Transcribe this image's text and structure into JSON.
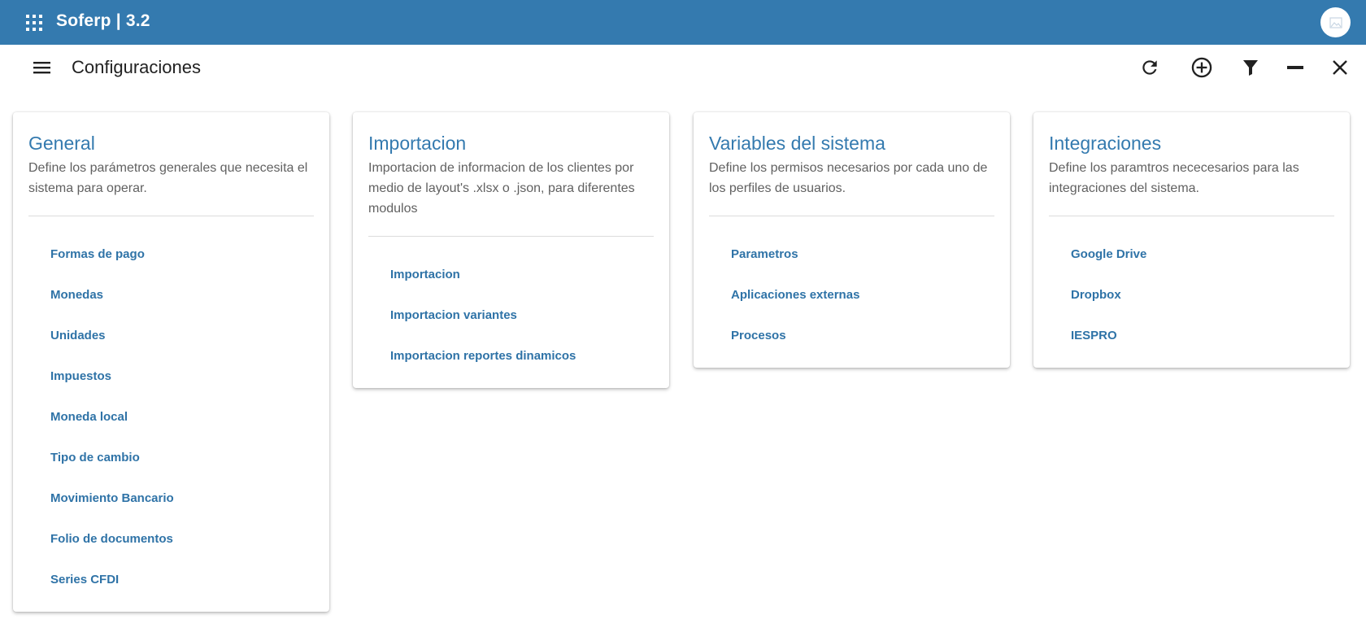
{
  "header": {
    "app_title": "Soferp | 3.2",
    "apps_icon": "apps-grid-icon",
    "avatar_icon": "image-placeholder-icon"
  },
  "toolbar": {
    "page_title": "Configuraciones",
    "icons": [
      "menu-icon",
      "refresh-icon",
      "add-circle-icon",
      "filter-icon",
      "minimize-icon",
      "close-icon"
    ]
  },
  "cards": [
    {
      "title": "General",
      "description": "Define los parámetros generales que necesita el sistema para operar.",
      "links": [
        "Formas de pago",
        "Monedas",
        "Unidades",
        "Impuestos",
        "Moneda local",
        "Tipo de cambio",
        "Movimiento Bancario",
        "Folio de documentos",
        "Series CFDI"
      ]
    },
    {
      "title": "Importacion",
      "description": "Importacion de informacion de los clientes por medio de layout's .xlsx o .json, para diferentes modulos",
      "links": [
        "Importacion",
        "Importacion variantes",
        "Importacion reportes dinamicos"
      ]
    },
    {
      "title": "Variables del sistema",
      "description": "Define los permisos necesarios por cada uno de los perfiles de usuarios.",
      "links": [
        "Parametros",
        "Aplicaciones externas",
        "Procesos"
      ]
    },
    {
      "title": "Integraciones",
      "description": "Define los paramtros nececesarios para las integraciones del sistema.",
      "links": [
        "Google Drive",
        "Dropbox",
        "IESPRO"
      ]
    }
  ],
  "colors": {
    "primary": "#347aaf",
    "link": "#2f73a7",
    "text_secondary": "#616161"
  }
}
